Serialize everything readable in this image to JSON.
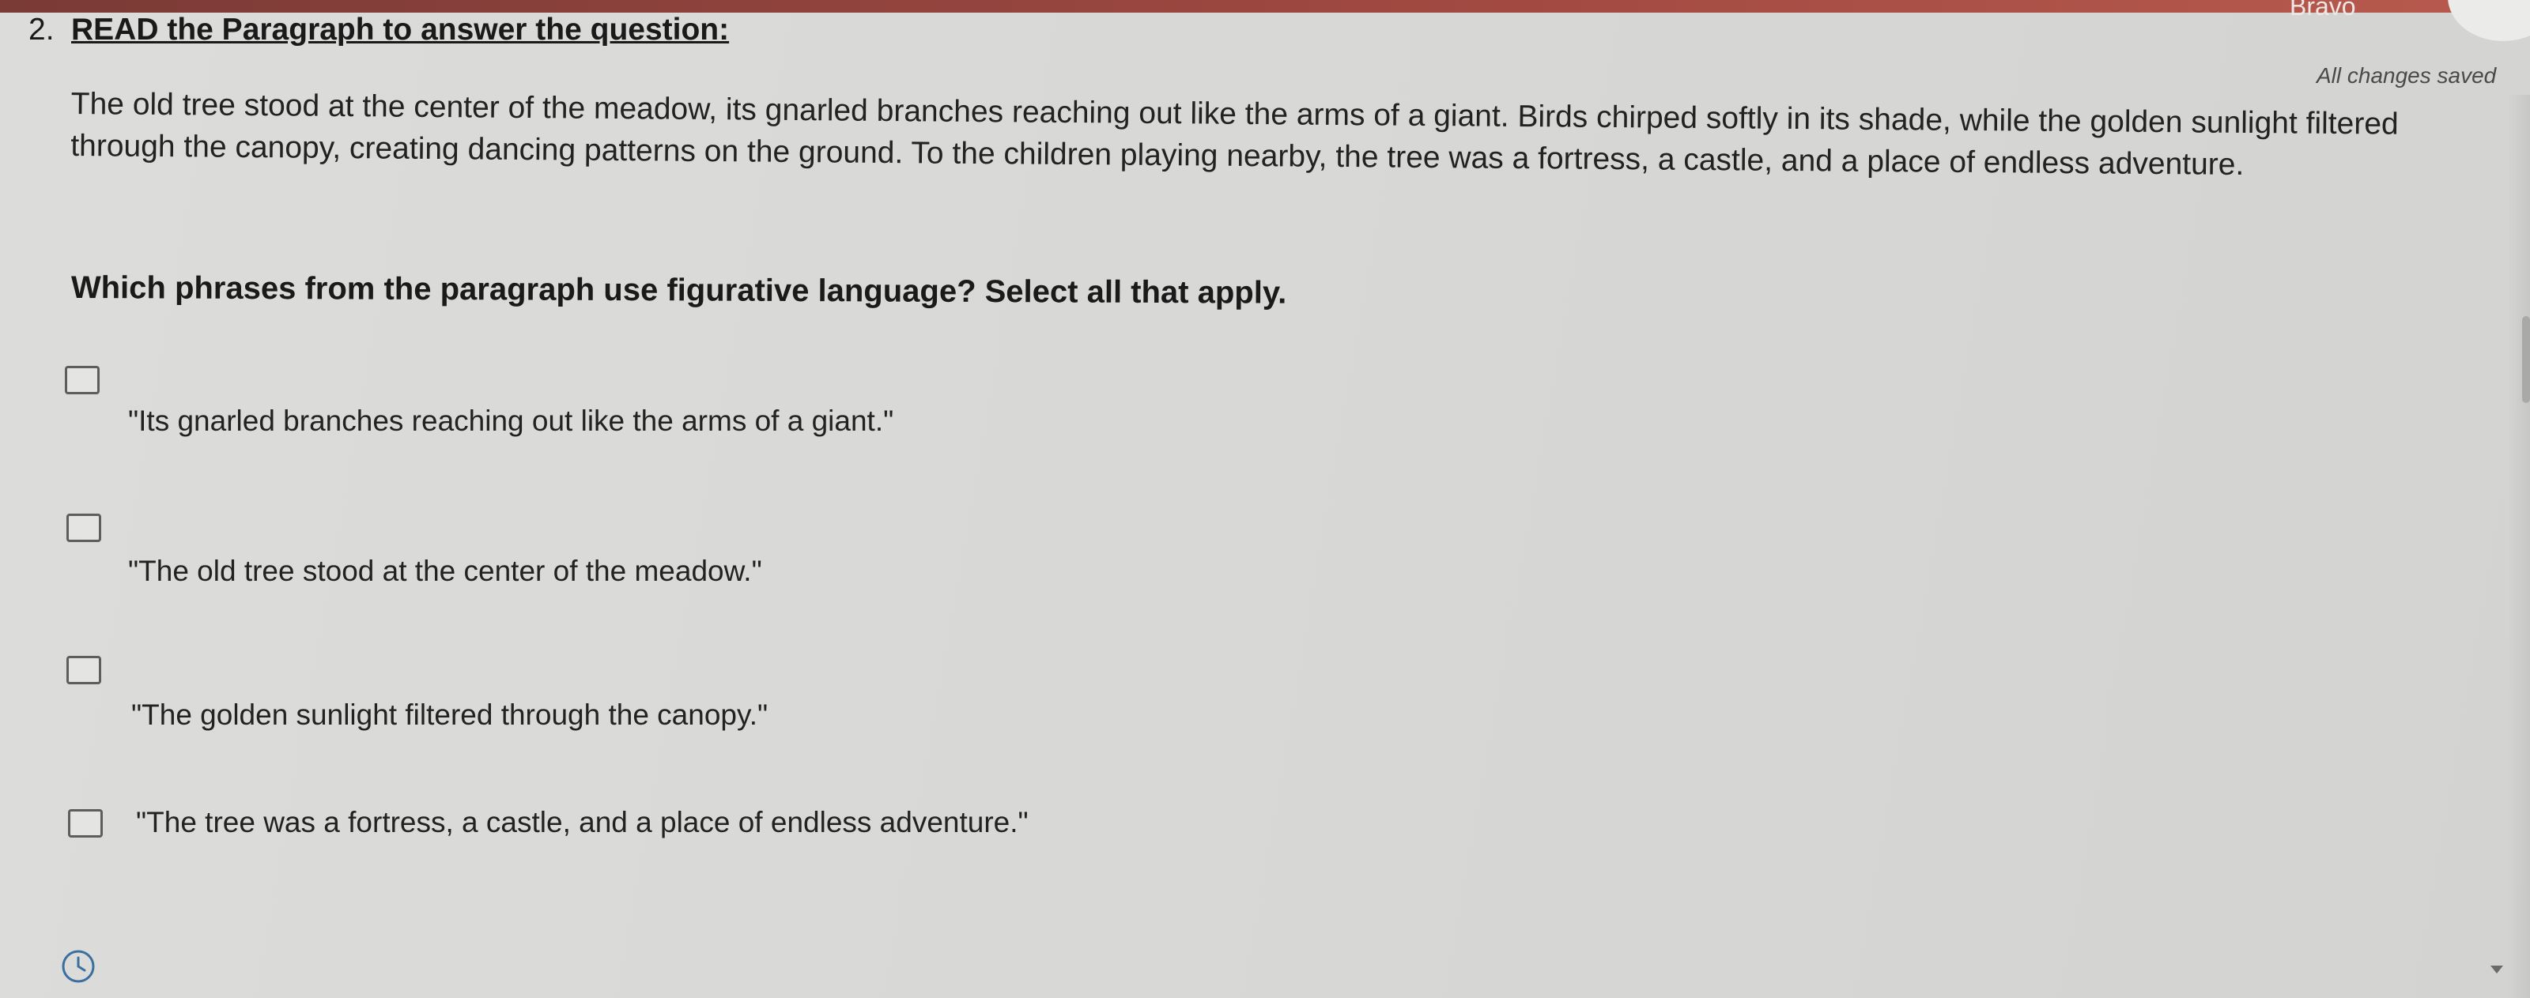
{
  "header": {
    "brand": "Bravo",
    "save_status": "All changes saved"
  },
  "question": {
    "number": "2.",
    "title": "READ the Paragraph to answer the question:",
    "passage": "The old tree stood at the center of the meadow, its gnarled branches reaching out like the arms of a giant. Birds chirped softly in its shade, while the golden sunlight filtered through the canopy, creating dancing patterns on the ground. To the children playing nearby, the tree was a fortress, a castle, and a place of endless adventure.",
    "prompt": "Which phrases from the paragraph use figurative language? Select all that apply."
  },
  "options": [
    {
      "label": "\"Its gnarled branches reaching out like the arms of a giant.\"",
      "checked": false
    },
    {
      "label": "\"The old tree stood at the center of the meadow.\"",
      "checked": false
    },
    {
      "label": "\"The golden sunlight filtered through the canopy.\"",
      "checked": false
    },
    {
      "label": "\"The tree was a fortress, a castle, and a place of endless adventure.\"",
      "checked": false
    }
  ],
  "icons": {
    "timer": "clock-icon",
    "scroll": "scroll-down-arrow-icon"
  },
  "colors": {
    "top_bar": "#a24a42",
    "background": "#d8d8d6",
    "text": "#222222"
  }
}
